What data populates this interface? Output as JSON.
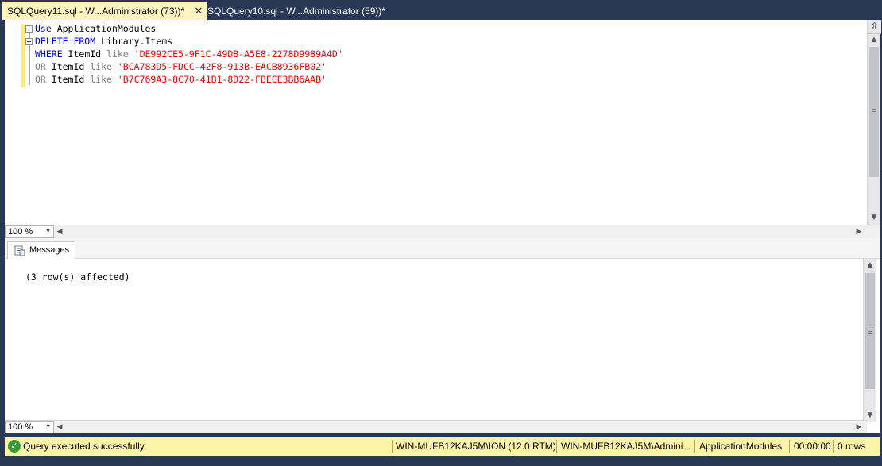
{
  "tabs": [
    {
      "label": "SQLQuery11.sql - W...Administrator (73))*",
      "close": "✕",
      "active": true
    },
    {
      "label": "SQLQuery10.sql - W...Administrator (59))*",
      "active": false
    }
  ],
  "editor": {
    "lines": [
      [
        {
          "t": "Use",
          "c": "kw"
        },
        {
          "t": " ApplicationModules",
          "c": ""
        }
      ],
      [
        {
          "t": "DELETE FROM",
          "c": "kw"
        },
        {
          "t": " Library.Items",
          "c": ""
        }
      ],
      [
        {
          "t": "WHERE",
          "c": "kw"
        },
        {
          "t": " ItemId ",
          "c": ""
        },
        {
          "t": "like",
          "c": "op"
        },
        {
          "t": " 'DE992CE5-9F1C-49DB-A5E8-2278D9989A4D'",
          "c": "str"
        }
      ],
      [
        {
          "t": "OR",
          "c": "op"
        },
        {
          "t": " ItemId ",
          "c": ""
        },
        {
          "t": "like",
          "c": "op"
        },
        {
          "t": " 'BCA783D5-FDCC-42F8-913B-EACB8936FB02'",
          "c": "str"
        }
      ],
      [
        {
          "t": "OR",
          "c": "op"
        },
        {
          "t": " ItemId ",
          "c": ""
        },
        {
          "t": "like",
          "c": "op"
        },
        {
          "t": " 'B7C769A3-8C70-41B1-8D22-FBECE3BB6AAB'",
          "c": "str"
        }
      ]
    ],
    "zoom": "100 %"
  },
  "results": {
    "tab_label": "Messages",
    "message": "(3 row(s) affected)",
    "zoom": "100 %"
  },
  "statusbar": {
    "status": "Query executed successfully.",
    "server": "WIN-MUFB12KAJ5M\\ION (12.0 RTM)",
    "user": "WIN-MUFB12KAJ5M\\Admini...",
    "database": "ApplicationModules",
    "elapsed": "00:00:00",
    "rows": "0 rows"
  },
  "colors": {
    "keyword": "#0000ff",
    "operator": "#808080",
    "string": "#ff0000",
    "status_bar": "#fff3a8",
    "active_tab": "#fdf4bf",
    "chrome": "#293955"
  }
}
